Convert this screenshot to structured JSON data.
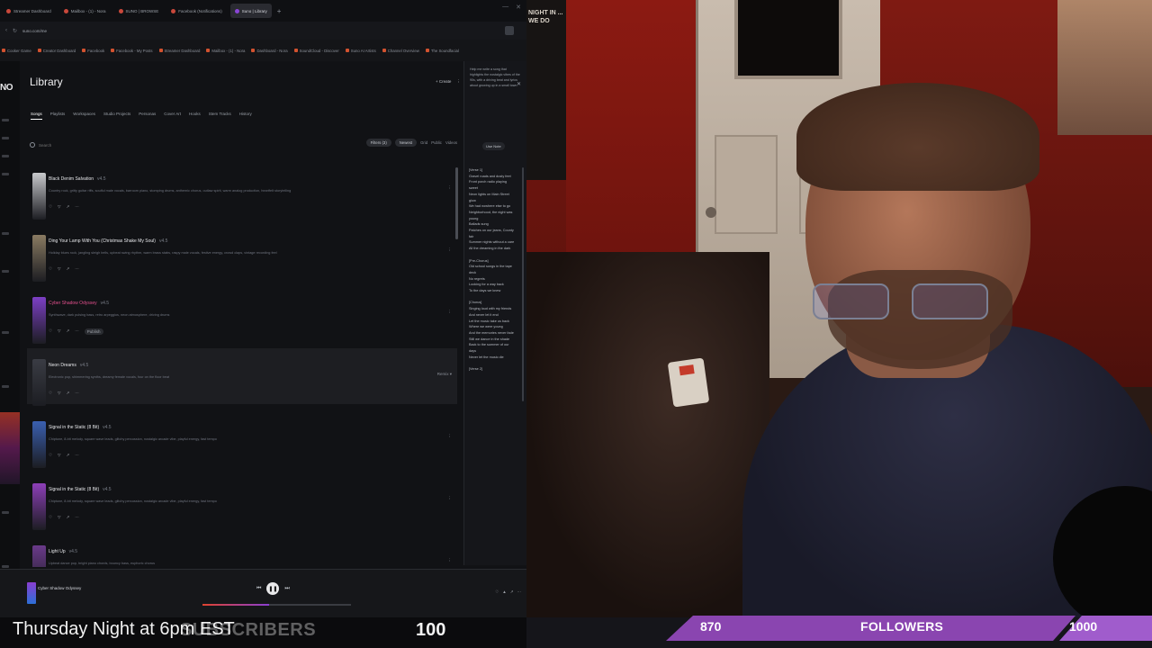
{
  "browser": {
    "tabs": [
      {
        "label": "Streamer Dashboard",
        "active": false
      },
      {
        "label": "Mailbox - (1) - Nora",
        "active": false
      },
      {
        "label": "SUNO | BROWSE",
        "active": false
      },
      {
        "label": "Facebook (Notifications)",
        "active": false
      },
      {
        "label": "Suno | Library",
        "active": true
      }
    ],
    "url": "suno.com/me",
    "bookmarks": [
      "Cooker Game",
      "Creator Dashboard",
      "Facebook",
      "Facebook - My Posts",
      "Streamer Dashboard",
      "Mailbox - (1) - Nora",
      "Dashboard - Nora",
      "SoundCloud - Discover",
      "Suno AI Artists",
      "Channel Overview",
      "The Soundfacial"
    ]
  },
  "app": {
    "logo": "NO",
    "title": "Library",
    "header_actions": [
      "+ Create",
      "⋮"
    ],
    "tabs": [
      {
        "label": "Songs",
        "active": true
      },
      {
        "label": "Playlists",
        "active": false
      },
      {
        "label": "Workspaces",
        "active": false
      },
      {
        "label": "Studio Projects",
        "active": false
      },
      {
        "label": "Personas",
        "active": false
      },
      {
        "label": "Cover Art",
        "active": false
      },
      {
        "label": "Hooks",
        "active": false
      },
      {
        "label": "Stem Tracks",
        "active": false
      },
      {
        "label": "History",
        "active": false
      }
    ],
    "search": {
      "placeholder": "Search",
      "value": ""
    },
    "filters": {
      "filter_label": "Filters (3)",
      "sort_label": "Newest",
      "toggles": [
        "Grid",
        "Public",
        "Videos"
      ]
    },
    "songs": [
      {
        "title": "Black Denim Salvation",
        "version": "v4.5",
        "desc": "Country rock, gritty guitar riffs, soulful male vocals, barroom piano, stomping drums, anthemic chorus, outlaw spirit, warm analog production, heartfelt storytelling",
        "thumb_color": "#c8c9cc",
        "title_color": "normal",
        "extra": "",
        "right": ""
      },
      {
        "title": "Ding Your Lamp With You (Christmas Shake My Soul)",
        "version": "v4.5",
        "desc": "Holiday blues rock, jangling sleigh bells, upbeat swing rhythm, warm brass stabs, raspy male vocals, festive energy, crowd claps, vintage recording feel",
        "thumb_color": "#8a7b62",
        "title_color": "normal",
        "extra": "",
        "right": ""
      },
      {
        "title": "Cyber Shadow Odyssey",
        "version": "v4.5",
        "desc": "Synthwave, dark pulsing bass, retro arpeggios, neon atmosphere, driving drums",
        "thumb_color": "#7c3fc4",
        "title_color": "pink",
        "extra": "Publish",
        "right": ""
      },
      {
        "title": "Neon Dreams",
        "version": "v4.5",
        "desc": "Electronic pop, shimmering synths, dreamy female vocals, four on the floor beat",
        "thumb_color": "#3a3c44",
        "title_color": "normal",
        "extra": "",
        "right": "Remix ▾"
      },
      {
        "title": "Signal in the Static (8 Bit)",
        "version": "v4.5",
        "desc": "Chiptune, 8-bit melody, square wave leads, glitchy percussion, nostalgic arcade vibe, playful energy, fast tempo",
        "thumb_color": "#3a5fb0",
        "title_color": "normal",
        "extra": "",
        "right": ""
      },
      {
        "title": "Signal in the Static (8 Bit)",
        "version": "v4.5",
        "desc": "Chiptune, 8-bit melody, square wave leads, glitchy percussion, nostalgic arcade vibe, playful energy, fast tempo",
        "thumb_color": "#8d3fb8",
        "title_color": "normal",
        "extra": "",
        "right": ""
      },
      {
        "title": "Light Up",
        "version": "v4.5",
        "desc": "Upbeat dance pop, bright piano chords, bouncy bass, euphoric chorus",
        "thumb_color": "#6a3a8a",
        "title_color": "normal",
        "extra": "",
        "right": ""
      }
    ],
    "lyrics_panel": {
      "note": "Help me write a song that highlights the nostalgic vibes of the 90s, with a driving beat and lyrics about growing up in a small town.",
      "button": "Use Note",
      "body": "[Verse 1]\nGravel roads and dusty feet\nFront porch radio playing sweet\nNeon lights on Main Street glow\nWe had nowhere else to go\nNeighborhood, the night was young\nBallads sung\nPatches on our jeans, County fair\nSummer nights without a care\nAll the dreaming in the dark\n\n[Pre-Chorus]\nOld school songs in the tape deck\nNo regrets\nLooking for a way back\nTo the days we knew\n\n[Chorus]\nSinging loud with my friends\nAnd never let it end\nLet the music take us back\nWhere we were young\nAnd the memories never fade\nStill we dance in the shade\nBack to the summer of our days\nNever let the music die\n\n[Verse 2]"
    }
  },
  "player": {
    "title": "Cyber Shadow Odyssey",
    "progress": 0.45,
    "right_icons": [
      "heart",
      "thumbs-up",
      "share",
      "more"
    ]
  },
  "overlay": {
    "ticker": "Thursday Night at 6pm EST",
    "subscribers_label": "SUBSCRIBERS",
    "subscribers_goal": "100",
    "followers_current": "870",
    "followers_label": "FOLLOWERS",
    "followers_goal": "1000",
    "follow_progress": 0.87,
    "bar_color": "#8a45b0"
  },
  "webcam": {
    "poster_text": "NIGHT IN ... WE DO"
  }
}
